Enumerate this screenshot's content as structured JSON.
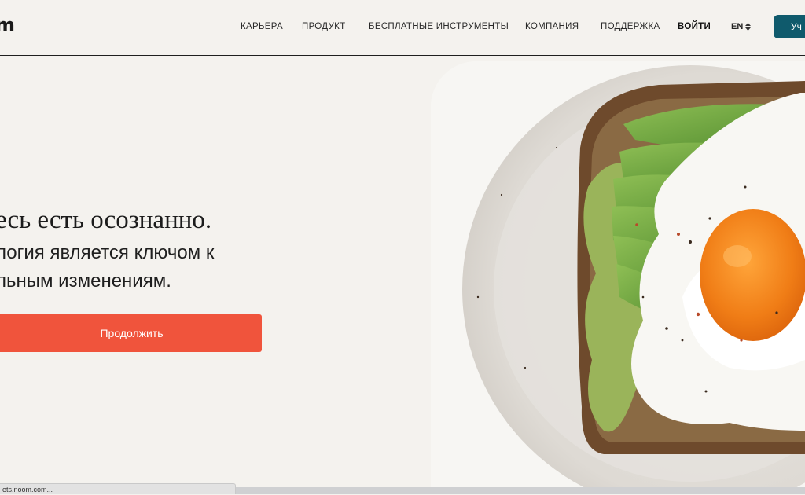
{
  "header": {
    "logo_text": "m",
    "nav": [
      {
        "label": "КАРЬЕРА"
      },
      {
        "label": "ПРОДУКТ"
      },
      {
        "label": "БЕСПЛАТНЫЕ ИНСТРУМЕНТЫ"
      },
      {
        "label": "КОМПАНИЯ"
      },
      {
        "label": "ПОДДЕРЖКА"
      }
    ],
    "login_label": "ВОЙТИ",
    "language": "EN",
    "cta_label": "Уч"
  },
  "hero": {
    "headline": "есь есть осознанно.",
    "subline_1": "логия является ключом к",
    "subline_2": "льным изменениям.",
    "continue_label": "Продолжить"
  },
  "status_bar": {
    "url": "ets.noom.com..."
  },
  "colors": {
    "background": "#f4f2ee",
    "accent_button": "#f0543c",
    "brand_teal": "#0f5a6c"
  }
}
